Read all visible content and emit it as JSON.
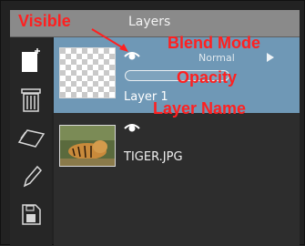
{
  "panel": {
    "title": "Layers"
  },
  "layers": [
    {
      "name": "Layer 1",
      "blend_mode": "Normal",
      "selected": true,
      "visible": true
    },
    {
      "name": "TIGER.JPG",
      "selected": false,
      "visible": true
    }
  ],
  "annotations": {
    "visible": "Visible",
    "blend_mode": "Blend Mode",
    "opacity": "Opacity",
    "layer_name": "Layer Name"
  },
  "sidebar": {
    "icons": [
      "new-layer-icon",
      "trash-icon",
      "layer-options-icon",
      "pencil-icon",
      "save-icon"
    ]
  },
  "colors": {
    "selected_row": "#6f98b6",
    "annotation": "#ff2020",
    "header": "#8a8a8a"
  }
}
